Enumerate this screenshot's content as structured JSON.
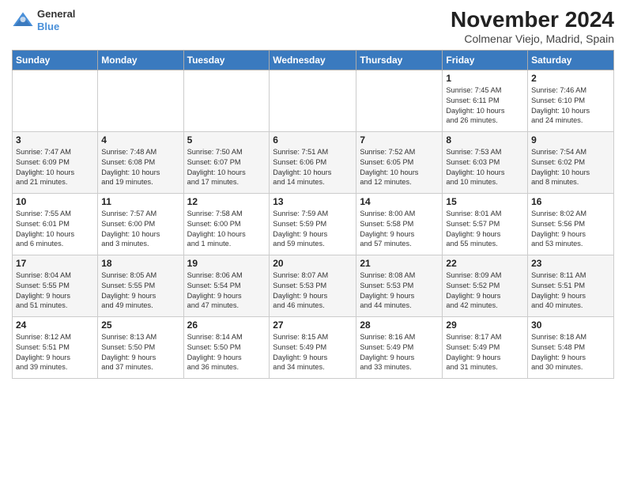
{
  "header": {
    "logo_line1": "General",
    "logo_line2": "Blue",
    "month_title": "November 2024",
    "location": "Colmenar Viejo, Madrid, Spain"
  },
  "weekdays": [
    "Sunday",
    "Monday",
    "Tuesday",
    "Wednesday",
    "Thursday",
    "Friday",
    "Saturday"
  ],
  "weeks": [
    [
      {
        "day": "",
        "info": ""
      },
      {
        "day": "",
        "info": ""
      },
      {
        "day": "",
        "info": ""
      },
      {
        "day": "",
        "info": ""
      },
      {
        "day": "",
        "info": ""
      },
      {
        "day": "1",
        "info": "Sunrise: 7:45 AM\nSunset: 6:11 PM\nDaylight: 10 hours\nand 26 minutes."
      },
      {
        "day": "2",
        "info": "Sunrise: 7:46 AM\nSunset: 6:10 PM\nDaylight: 10 hours\nand 24 minutes."
      }
    ],
    [
      {
        "day": "3",
        "info": "Sunrise: 7:47 AM\nSunset: 6:09 PM\nDaylight: 10 hours\nand 21 minutes."
      },
      {
        "day": "4",
        "info": "Sunrise: 7:48 AM\nSunset: 6:08 PM\nDaylight: 10 hours\nand 19 minutes."
      },
      {
        "day": "5",
        "info": "Sunrise: 7:50 AM\nSunset: 6:07 PM\nDaylight: 10 hours\nand 17 minutes."
      },
      {
        "day": "6",
        "info": "Sunrise: 7:51 AM\nSunset: 6:06 PM\nDaylight: 10 hours\nand 14 minutes."
      },
      {
        "day": "7",
        "info": "Sunrise: 7:52 AM\nSunset: 6:05 PM\nDaylight: 10 hours\nand 12 minutes."
      },
      {
        "day": "8",
        "info": "Sunrise: 7:53 AM\nSunset: 6:03 PM\nDaylight: 10 hours\nand 10 minutes."
      },
      {
        "day": "9",
        "info": "Sunrise: 7:54 AM\nSunset: 6:02 PM\nDaylight: 10 hours\nand 8 minutes."
      }
    ],
    [
      {
        "day": "10",
        "info": "Sunrise: 7:55 AM\nSunset: 6:01 PM\nDaylight: 10 hours\nand 6 minutes."
      },
      {
        "day": "11",
        "info": "Sunrise: 7:57 AM\nSunset: 6:00 PM\nDaylight: 10 hours\nand 3 minutes."
      },
      {
        "day": "12",
        "info": "Sunrise: 7:58 AM\nSunset: 6:00 PM\nDaylight: 10 hours\nand 1 minute."
      },
      {
        "day": "13",
        "info": "Sunrise: 7:59 AM\nSunset: 5:59 PM\nDaylight: 9 hours\nand 59 minutes."
      },
      {
        "day": "14",
        "info": "Sunrise: 8:00 AM\nSunset: 5:58 PM\nDaylight: 9 hours\nand 57 minutes."
      },
      {
        "day": "15",
        "info": "Sunrise: 8:01 AM\nSunset: 5:57 PM\nDaylight: 9 hours\nand 55 minutes."
      },
      {
        "day": "16",
        "info": "Sunrise: 8:02 AM\nSunset: 5:56 PM\nDaylight: 9 hours\nand 53 minutes."
      }
    ],
    [
      {
        "day": "17",
        "info": "Sunrise: 8:04 AM\nSunset: 5:55 PM\nDaylight: 9 hours\nand 51 minutes."
      },
      {
        "day": "18",
        "info": "Sunrise: 8:05 AM\nSunset: 5:55 PM\nDaylight: 9 hours\nand 49 minutes."
      },
      {
        "day": "19",
        "info": "Sunrise: 8:06 AM\nSunset: 5:54 PM\nDaylight: 9 hours\nand 47 minutes."
      },
      {
        "day": "20",
        "info": "Sunrise: 8:07 AM\nSunset: 5:53 PM\nDaylight: 9 hours\nand 46 minutes."
      },
      {
        "day": "21",
        "info": "Sunrise: 8:08 AM\nSunset: 5:53 PM\nDaylight: 9 hours\nand 44 minutes."
      },
      {
        "day": "22",
        "info": "Sunrise: 8:09 AM\nSunset: 5:52 PM\nDaylight: 9 hours\nand 42 minutes."
      },
      {
        "day": "23",
        "info": "Sunrise: 8:11 AM\nSunset: 5:51 PM\nDaylight: 9 hours\nand 40 minutes."
      }
    ],
    [
      {
        "day": "24",
        "info": "Sunrise: 8:12 AM\nSunset: 5:51 PM\nDaylight: 9 hours\nand 39 minutes."
      },
      {
        "day": "25",
        "info": "Sunrise: 8:13 AM\nSunset: 5:50 PM\nDaylight: 9 hours\nand 37 minutes."
      },
      {
        "day": "26",
        "info": "Sunrise: 8:14 AM\nSunset: 5:50 PM\nDaylight: 9 hours\nand 36 minutes."
      },
      {
        "day": "27",
        "info": "Sunrise: 8:15 AM\nSunset: 5:49 PM\nDaylight: 9 hours\nand 34 minutes."
      },
      {
        "day": "28",
        "info": "Sunrise: 8:16 AM\nSunset: 5:49 PM\nDaylight: 9 hours\nand 33 minutes."
      },
      {
        "day": "29",
        "info": "Sunrise: 8:17 AM\nSunset: 5:49 PM\nDaylight: 9 hours\nand 31 minutes."
      },
      {
        "day": "30",
        "info": "Sunrise: 8:18 AM\nSunset: 5:48 PM\nDaylight: 9 hours\nand 30 minutes."
      }
    ]
  ]
}
